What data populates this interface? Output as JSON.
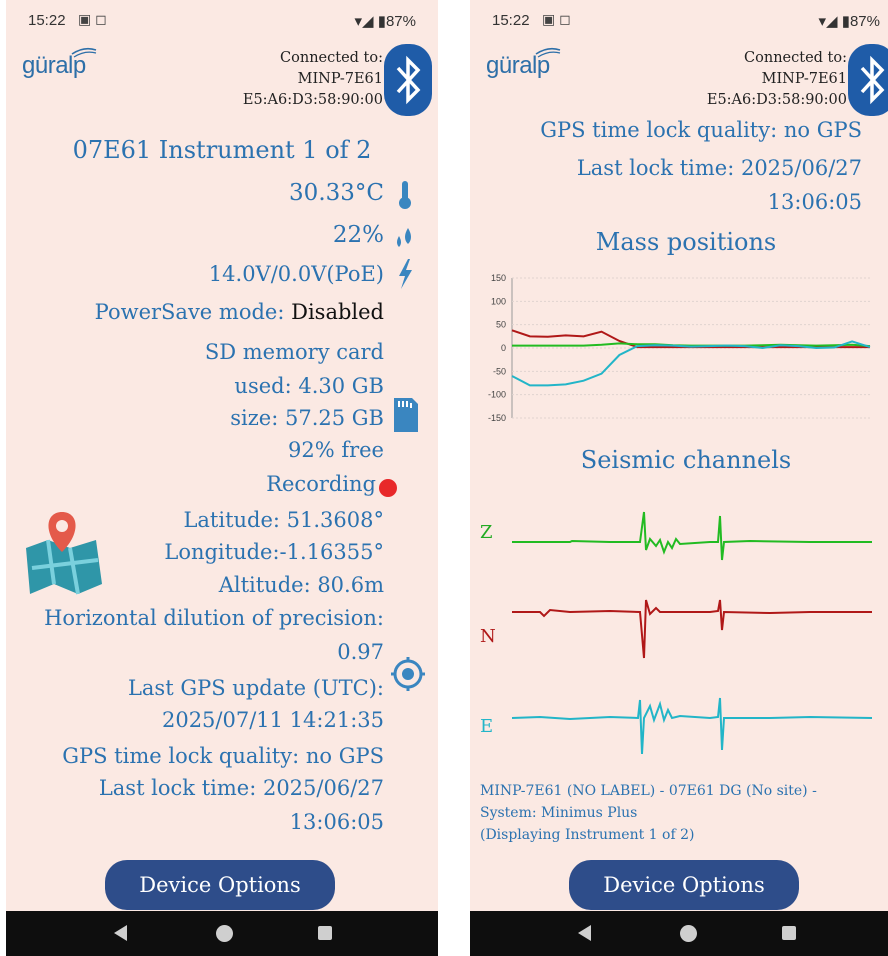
{
  "status": {
    "time": "15:22",
    "battery": "87%"
  },
  "connection": {
    "line1": "Connected to:",
    "line2": "MINP-7E61",
    "line3": "E5:A6:D3:58:90:00"
  },
  "left": {
    "title": "07E61 Instrument 1 of 2",
    "temperature": "30.33°C",
    "humidity": "22%",
    "power": "14.0V/0.0V(PoE)",
    "powersave_label": "PowerSave mode:",
    "powersave_value": "Disabled",
    "sd_title": "SD memory card",
    "sd_used": "used: 4.30 GB",
    "sd_size": "size: 57.25 GB",
    "sd_free": "92% free",
    "recording": "Recording",
    "latitude": "Latitude: 51.3608°",
    "longitude": "Longitude:-1.16355°",
    "altitude": "Altitude: 80.6m",
    "hdop_label": "Horizontal dilution of precision:",
    "hdop_value": "0.97",
    "gps_update_label": "Last GPS update (UTC):",
    "gps_update_value": "2025/07/11 14:21:35",
    "gps_lock_quality": "GPS time lock quality: no GPS",
    "last_lock_label": "Last lock time: 2025/06/27",
    "last_lock_time": "13:06:05"
  },
  "right": {
    "gps_lock_quality": "GPS time lock quality: no GPS",
    "last_lock_label": "Last lock time: 2025/06/27",
    "last_lock_time": "13:06:05",
    "mass_title": "Mass positions",
    "seismic_title": "Seismic channels",
    "channels": [
      "Z",
      "N",
      "E"
    ],
    "footer_line1": "MINP-7E61 (NO LABEL) - 07E61 DG (No site) -",
    "footer_line2": "System: Minimus Plus",
    "footer_line3": "(Displaying Instrument 1 of 2)"
  },
  "device_options": "Device Options",
  "colors": {
    "accent": "#2b72b0",
    "button": "#2e4d8a",
    "bluetooth": "#1f5ca8",
    "background": "#fbe9e3",
    "red_series": "#b01818",
    "green_series": "#22bb22",
    "cyan_series": "#22b5c8"
  },
  "chart_data": {
    "type": "line",
    "title": "Mass positions",
    "ylim": [
      -150,
      150
    ],
    "yticks": [
      "150",
      "100",
      "50",
      "0",
      "-50",
      "-100",
      "-150"
    ],
    "x": [
      0,
      1,
      2,
      3,
      4,
      5,
      6,
      7,
      8,
      9,
      10,
      11,
      12,
      13,
      14,
      15,
      16,
      17,
      18,
      19,
      20
    ],
    "series": [
      {
        "values": [
          38,
          25,
          24,
          27,
          25,
          35,
          15,
          2,
          2,
          2,
          2,
          2,
          2,
          2,
          2,
          2,
          2,
          2,
          2,
          2,
          2
        ]
      },
      {
        "values": [
          5,
          5,
          5,
          5,
          5,
          7,
          10,
          8,
          8,
          6,
          5,
          5,
          5,
          5,
          6,
          7,
          6,
          5,
          6,
          7,
          4
        ]
      },
      {
        "values": [
          -60,
          -80,
          -80,
          -78,
          -70,
          -55,
          -15,
          4,
          6,
          5,
          3,
          4,
          5,
          4,
          0,
          6,
          4,
          0,
          1,
          14,
          2
        ]
      }
    ]
  }
}
